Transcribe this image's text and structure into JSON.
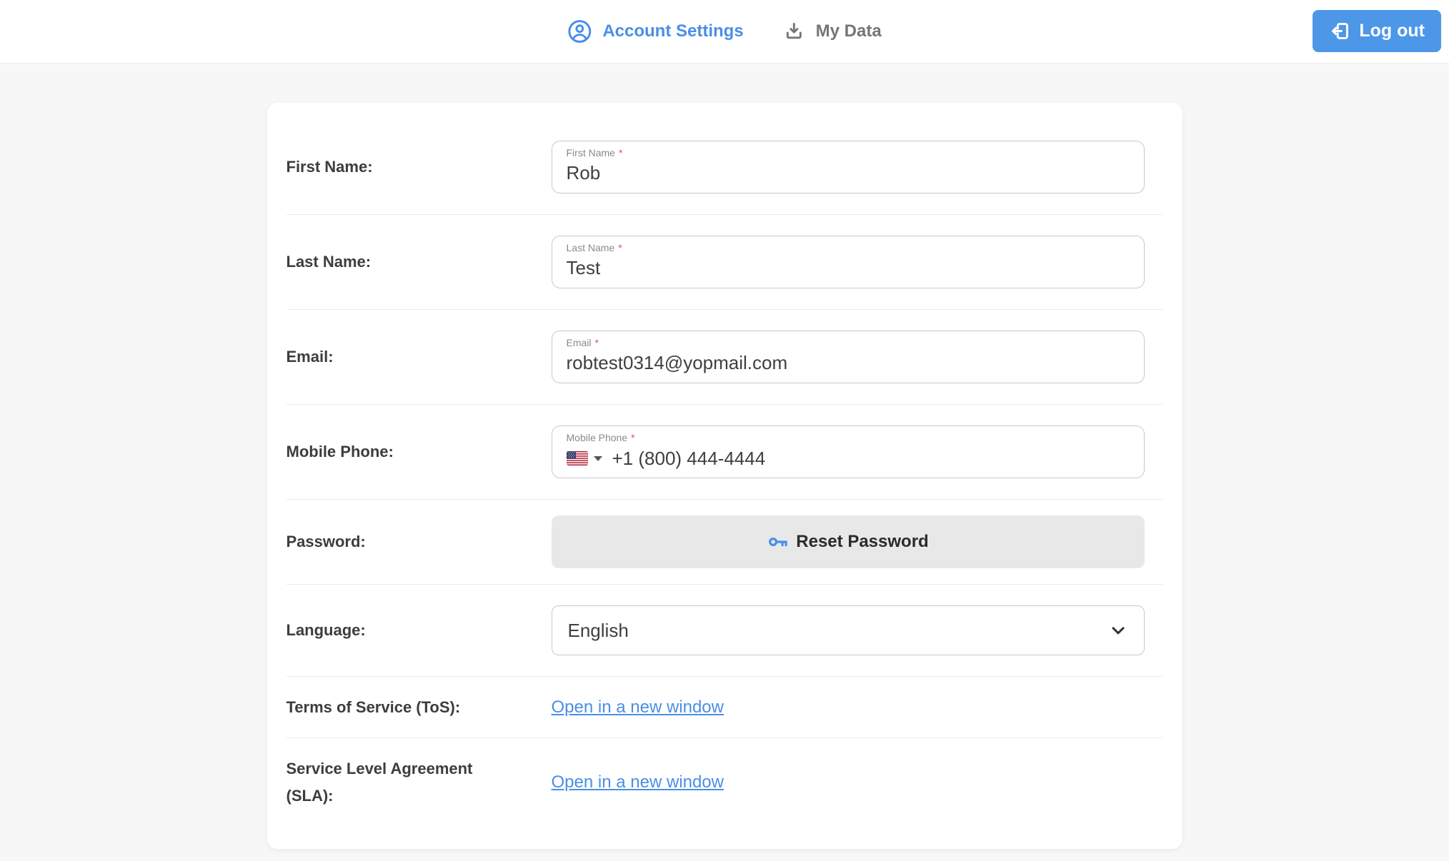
{
  "colors": {
    "accent_blue": "#4A8EE8",
    "logout_button_blue": "#4D97E8",
    "link_blue": "#4A8EE8",
    "required_asterisk_red": "#E05345",
    "page_background": "#F7F7F7",
    "card_background": "#FFFFFF",
    "divider": "#EAEAEA",
    "input_border": "#C9C9C9",
    "reset_button_background": "#E8E8E8",
    "row_label_text": "#3D3D3D",
    "inactive_tab_text": "#757575",
    "floating_label_text": "#8A8A8A"
  },
  "header": {
    "tabs": [
      {
        "label": "Account Settings",
        "icon": "user-circle-icon",
        "active": true
      },
      {
        "label": "My Data",
        "icon": "download-icon",
        "active": false
      }
    ],
    "logout": {
      "label": "Log out",
      "icon": "logout-icon"
    }
  },
  "form": {
    "first_name": {
      "row_label": "First Name:",
      "field_label": "First Name",
      "required_marker": "*",
      "value": "Rob"
    },
    "last_name": {
      "row_label": "Last Name:",
      "field_label": "Last Name",
      "required_marker": "*",
      "value": "Test"
    },
    "email": {
      "row_label": "Email:",
      "field_label": "Email",
      "required_marker": "*",
      "value": "robtest0314@yopmail.com"
    },
    "mobile_phone": {
      "row_label": "Mobile Phone:",
      "field_label": "Mobile Phone",
      "required_marker": "*",
      "value": "+1 (800) 444-4444",
      "country_flag": "us-flag-icon"
    },
    "password": {
      "row_label": "Password:",
      "button_label": "Reset Password",
      "button_icon": "key-icon"
    },
    "language": {
      "row_label": "Language:",
      "selected_value": "English"
    },
    "terms_of_service": {
      "row_label": "Terms of Service (ToS):",
      "link_label": "Open in a new window"
    },
    "service_level_agreement": {
      "row_label": "Service Level Agreement (SLA):",
      "link_label": "Open in a new window"
    }
  }
}
